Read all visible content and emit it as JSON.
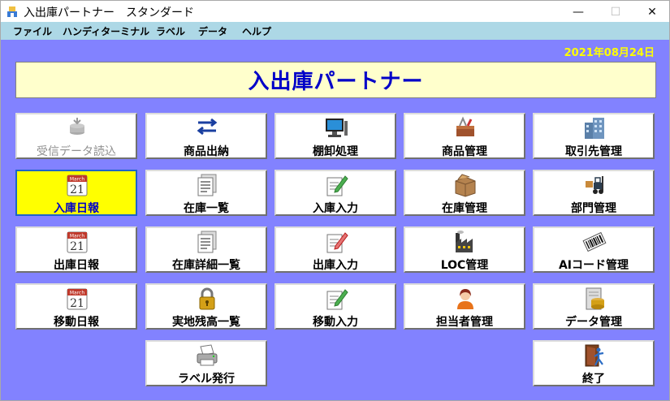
{
  "window": {
    "title": "入出庫パートナー　スタンダード",
    "min": "—",
    "max": "☐",
    "close": "✕"
  },
  "menu": [
    "ファイル",
    "ハンディターミナル",
    "ラベル",
    "データ",
    "ヘルプ"
  ],
  "date": "2021年08月24日",
  "banner": "入出庫パートナー",
  "tiles": [
    {
      "label": "受信データ読込",
      "icon": "data-receive-icon",
      "state": "disabled"
    },
    {
      "label": "商品出納",
      "icon": "transfer-arrows-icon"
    },
    {
      "label": "棚卸処理",
      "icon": "computer-icon"
    },
    {
      "label": "商品管理",
      "icon": "toolbox-icon"
    },
    {
      "label": "取引先管理",
      "icon": "building-icon"
    },
    {
      "label": "入庫日報",
      "icon": "calendar-icon",
      "state": "selected",
      "cal_month": "March",
      "cal_day": "21"
    },
    {
      "label": "在庫一覧",
      "icon": "document-list-icon"
    },
    {
      "label": "入庫入力",
      "icon": "edit-form-icon"
    },
    {
      "label": "在庫管理",
      "icon": "box-icon"
    },
    {
      "label": "部門管理",
      "icon": "forklift-icon"
    },
    {
      "label": "出庫日報",
      "icon": "calendar-icon",
      "cal_month": "March",
      "cal_day": "21"
    },
    {
      "label": "在庫詳細一覧",
      "icon": "document-list-icon"
    },
    {
      "label": "出庫入力",
      "icon": "edit-form-icon"
    },
    {
      "label": "LOC管理",
      "icon": "factory-icon"
    },
    {
      "label": "AIコード管理",
      "icon": "barcode-icon"
    },
    {
      "label": "移動日報",
      "icon": "calendar-icon",
      "cal_month": "March",
      "cal_day": "21"
    },
    {
      "label": "実地残高一覧",
      "icon": "lock-icon"
    },
    {
      "label": "移動入力",
      "icon": "edit-form-icon"
    },
    {
      "label": "担当者管理",
      "icon": "person-icon"
    },
    {
      "label": "データ管理",
      "icon": "database-icon"
    },
    {
      "label": "ラベル発行",
      "icon": "printer-icon"
    },
    {
      "label": "終了",
      "icon": "exit-door-icon"
    }
  ]
}
